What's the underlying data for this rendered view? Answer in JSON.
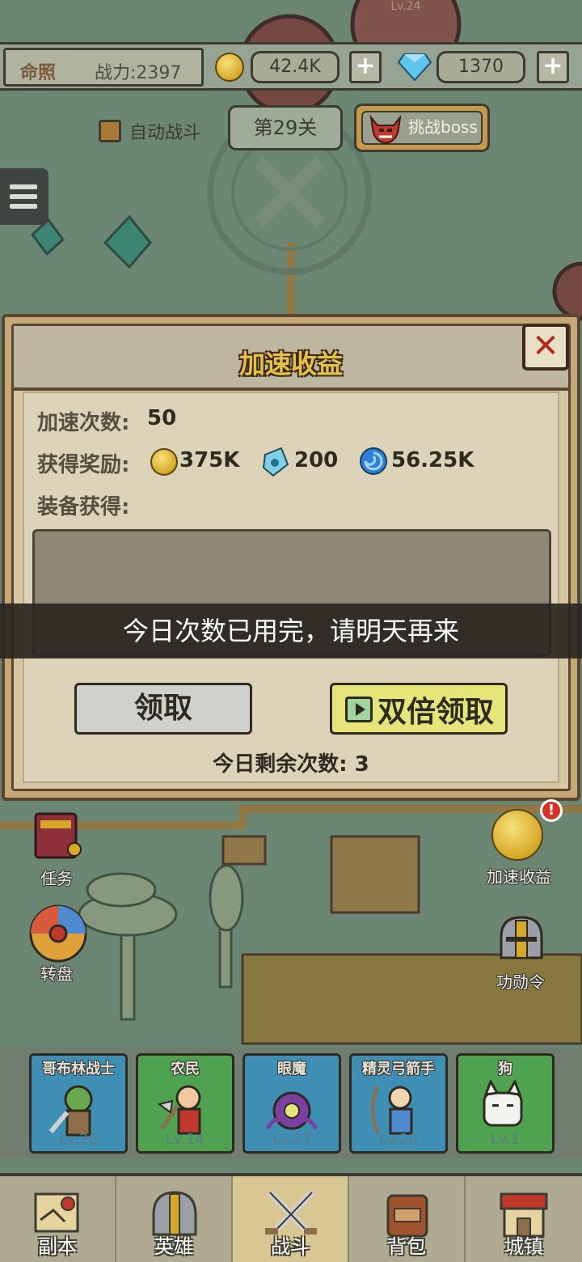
{
  "top_bar": {
    "license_label": "命照",
    "power_text": "战力:2397",
    "gold_amount": "42.4K",
    "gem_amount": "1370",
    "plus_symbol": "+"
  },
  "controls": {
    "auto_battle_label": "自动战斗",
    "auto_battle_checked": true,
    "stage_label": "第29关",
    "boss_button_label": "挑战boss"
  },
  "map": {
    "enemy_level": "Lv.24"
  },
  "dialog": {
    "title": "加速收益",
    "close_symbol": "✕",
    "speed_count_label": "加速次数:",
    "speed_count_value": "50",
    "reward_label": "获得奖励:",
    "rewards": [
      {
        "icon": "gold-coin-icon",
        "amount": "375K"
      },
      {
        "icon": "blue-stone-icon",
        "amount": "200"
      },
      {
        "icon": "blue-orb-icon",
        "amount": "56.25K"
      }
    ],
    "equipment_label": "装备获得:",
    "toast": "今日次数已用完，请明天再来",
    "claim_button": "领取",
    "double_claim_button": "双倍领取",
    "remaining_text": "今日剩余次数: 3"
  },
  "side_icons": {
    "task": "任务",
    "wheel": "转盘",
    "speed_income": "加速收益",
    "merit": "功勋令",
    "badge": "!"
  },
  "heroes": [
    {
      "name": "哥布林战士",
      "level": "Lv.20",
      "color": "#3f8fb5"
    },
    {
      "name": "农民",
      "level": "Lv.14",
      "color": "#4fa24f"
    },
    {
      "name": "眼魔",
      "level": "Lv.27",
      "color": "#3f8fb5"
    },
    {
      "name": "精灵弓箭手",
      "level": "Lv.20",
      "color": "#3f8fb5"
    },
    {
      "name": "狗",
      "level": "Lv.1",
      "color": "#4fa24f"
    }
  ],
  "bottom_nav": [
    {
      "label": "副本",
      "icon": "scroll-map-icon"
    },
    {
      "label": "英雄",
      "icon": "helmet-icon"
    },
    {
      "label": "战斗",
      "icon": "crossed-swords-icon",
      "active": true
    },
    {
      "label": "背包",
      "icon": "backpack-icon"
    },
    {
      "label": "城镇",
      "icon": "shop-building-icon"
    }
  ]
}
